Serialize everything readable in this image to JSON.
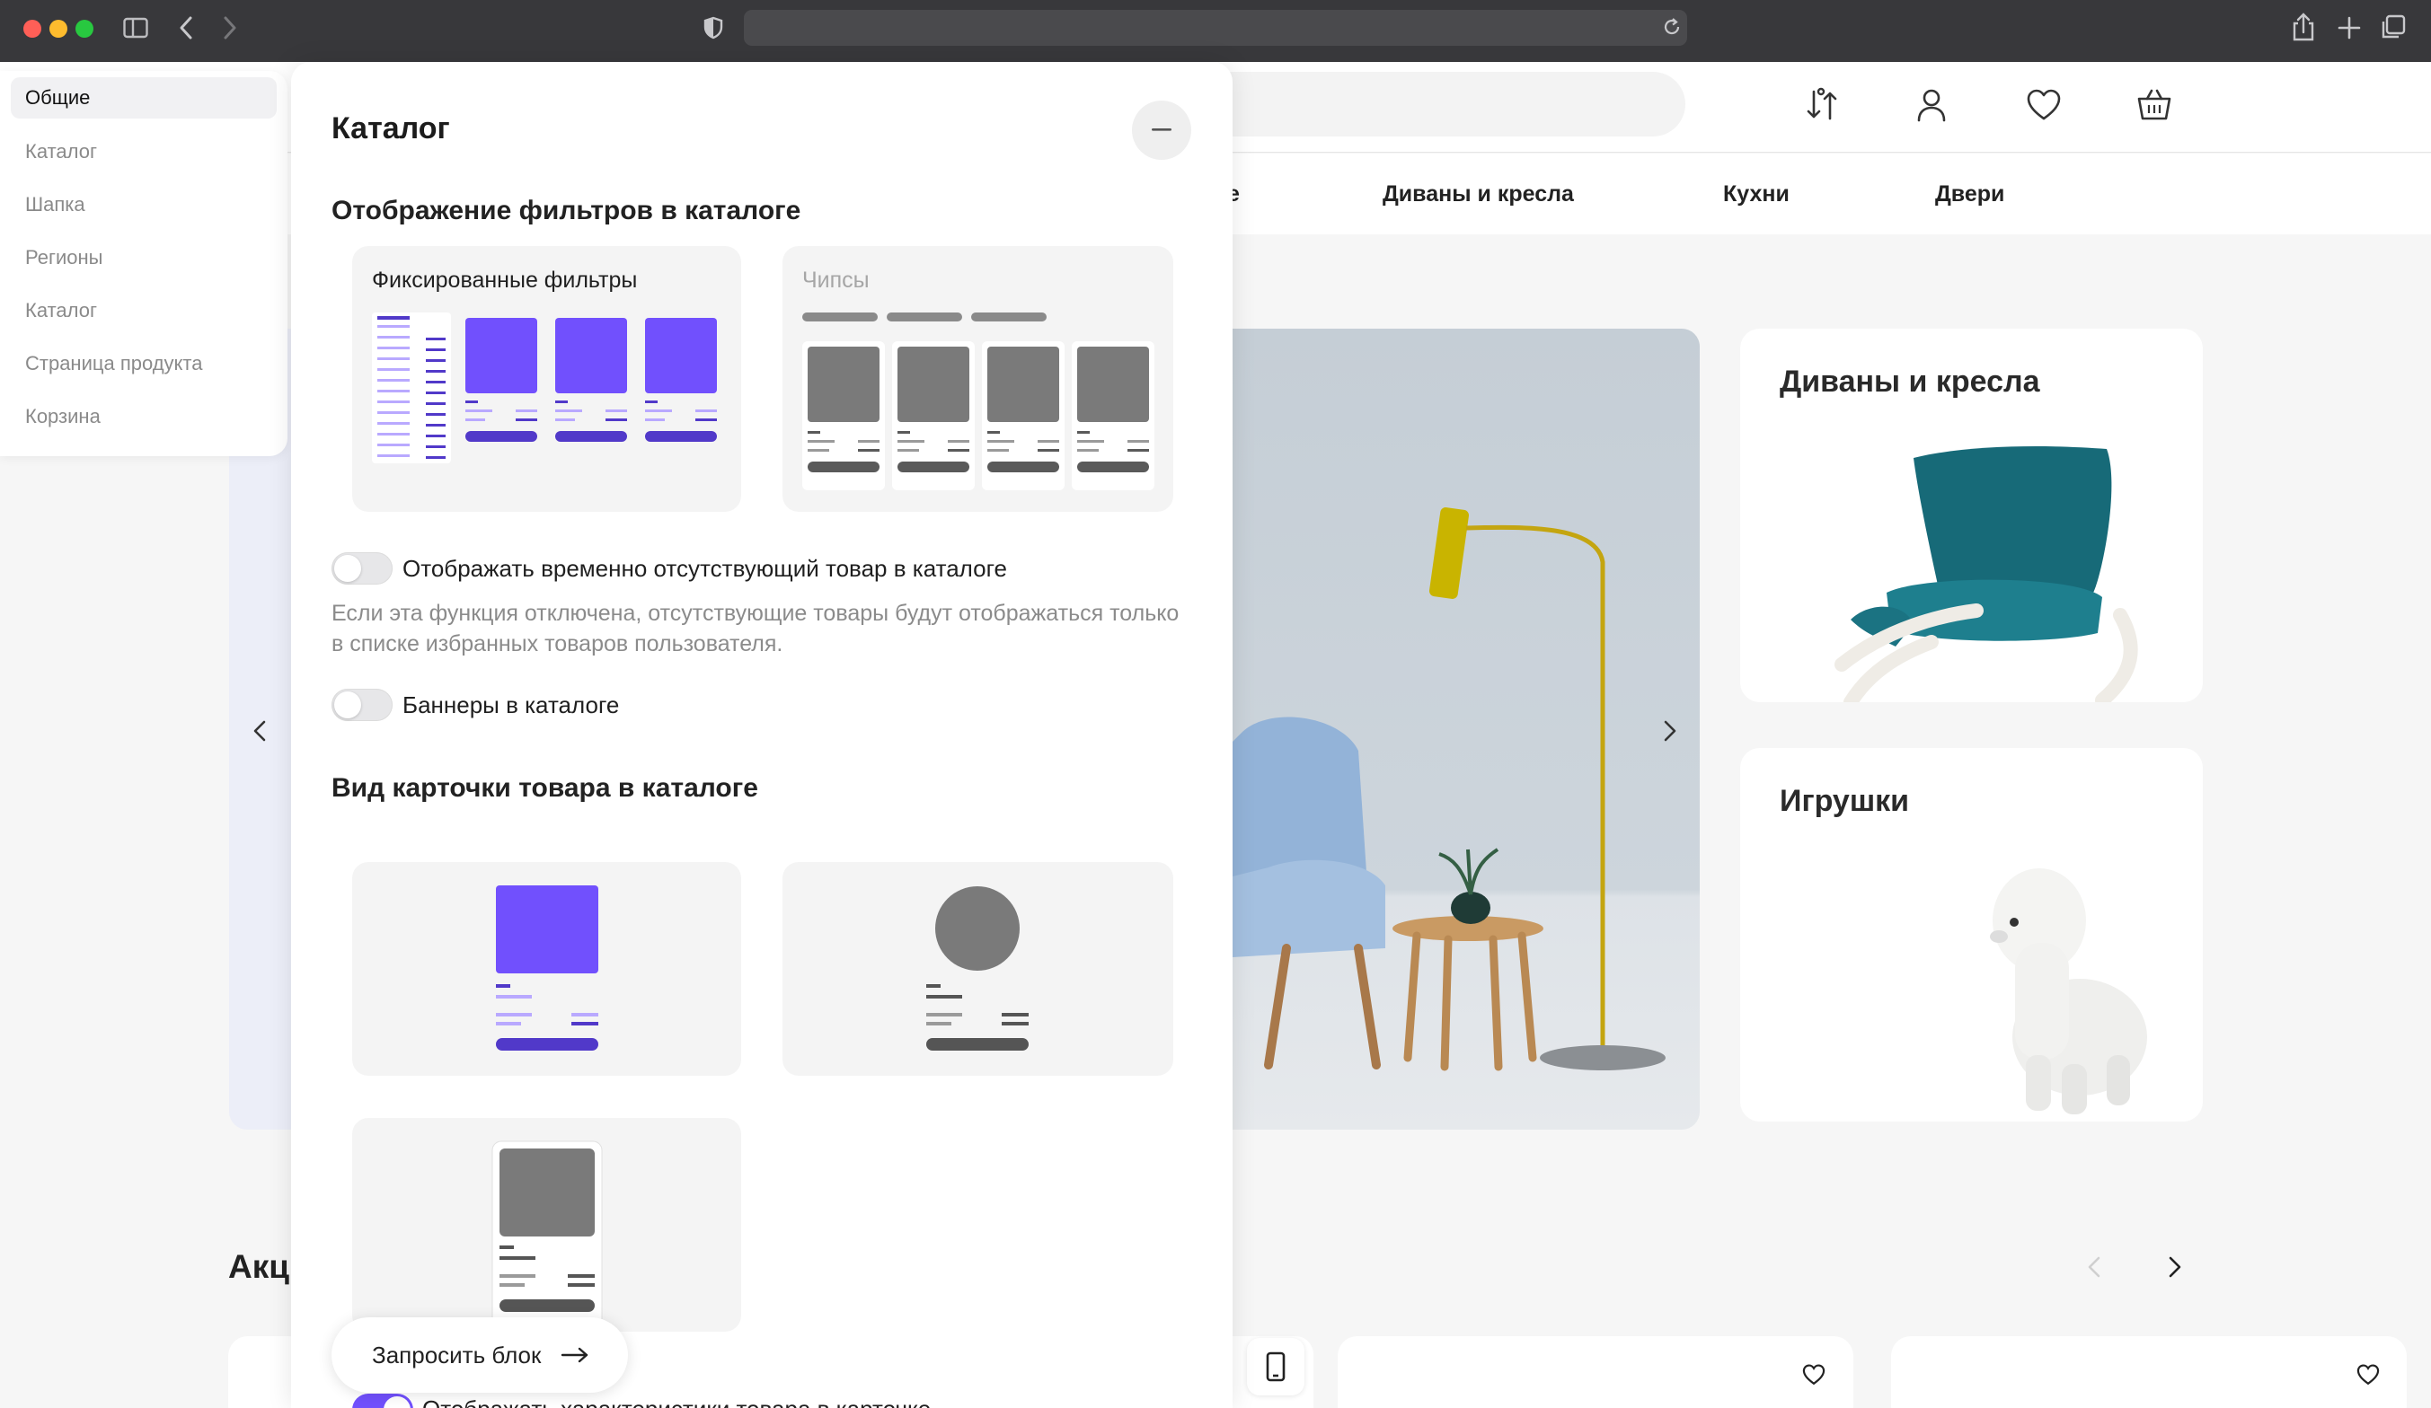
{
  "browser": {
    "buttons": [
      "sidebar-toggle",
      "back",
      "forward",
      "reload",
      "share",
      "new-tab",
      "tab-overview"
    ]
  },
  "site": {
    "nav": [
      "е",
      "Диваны и кресла",
      "Кухни",
      "Двери"
    ],
    "categories": [
      {
        "title": "Диваны и кресла"
      },
      {
        "title": "Игрушки"
      }
    ],
    "promo_title": "Акц",
    "colors": {
      "accent": "#7150FD",
      "accent_dark": "#4B30C8",
      "gray": "#7A7A7A"
    }
  },
  "sidebar": {
    "items": [
      {
        "label": "Общие",
        "active": true
      },
      {
        "label": "Каталог"
      },
      {
        "label": "Шапка"
      },
      {
        "label": "Регионы"
      },
      {
        "label": "Каталог"
      },
      {
        "label": "Страница продукта"
      },
      {
        "label": "Корзина"
      }
    ]
  },
  "panel": {
    "title": "Каталог",
    "filters_section": {
      "title": "Отображение фильтров в каталоге",
      "options": [
        {
          "label": "Фиксированные фильтры",
          "selected": true
        },
        {
          "label": "Чипсы",
          "selected": false
        }
      ]
    },
    "toggle_out_of_stock": {
      "label": "Отображать временно отсутствующий товар в каталоге",
      "on": false,
      "hint": "Если эта функция отключена, отсутствующие товары будут отображаться только в списке избранных товаров пользователя."
    },
    "toggle_banners": {
      "label": "Баннеры в каталоге",
      "on": false
    },
    "card_section": {
      "title": "Вид карточки товара в каталоге"
    },
    "request_button": "Запросить блок",
    "cut_off_label": "Отображать характеристики товара в карточке",
    "cut_off_toggle_on": true
  }
}
